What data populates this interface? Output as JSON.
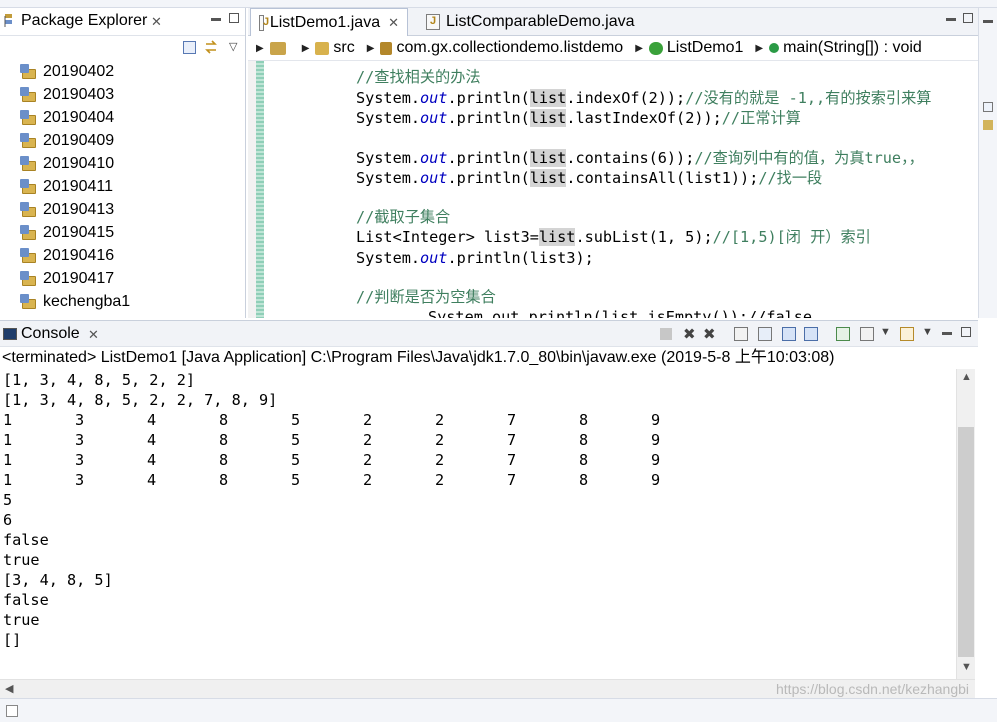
{
  "package_explorer": {
    "title": "Package Explorer",
    "close_glyph": "✕",
    "projects": [
      "20190402",
      "20190403",
      "20190404",
      "20190409",
      "20190410",
      "20190411",
      "20190413",
      "20190415",
      "20190416",
      "20190417",
      "kechengba1"
    ]
  },
  "editor": {
    "tabs": [
      {
        "label": "ListDemo1.java",
        "close_glyph": "✕"
      },
      {
        "label": "ListComparableDemo.java"
      }
    ],
    "breadcrumb": [
      "src",
      "com.gx.collectiondemo.listdemo",
      "ListDemo1",
      "main(String[]) : void"
    ],
    "code": {
      "l1": "//查找相关的办法",
      "l2_a": "System.",
      "l2_b": "out",
      "l2_c": ".println(",
      "l2_d": "list",
      "l2_e": ".indexOf(2));",
      "l2_f": "//没有的就是 -1,,有的按索引来算",
      "l3_a": "System.",
      "l3_b": "out",
      "l3_c": ".println(",
      "l3_d": "list",
      "l3_e": ".lastIndexOf(2));",
      "l3_f": "//正常计算",
      "l4_a": "System.",
      "l4_b": "out",
      "l4_c": ".println(",
      "l4_d": "list",
      "l4_e": ".contains(6));",
      "l4_f": "//查询列中有的值，为真true，，",
      "l5_a": "System.",
      "l5_b": "out",
      "l5_c": ".println(",
      "l5_d": "list",
      "l5_e": ".containsAll(list1));",
      "l5_f": "//找一段",
      "l6": "//截取子集合",
      "l7_a": "List<Integer> list3=",
      "l7_b": "list",
      "l7_c": ".subList(1, 5);",
      "l7_d": "//[1,5)[闭 开）索引",
      "l8_a": "System.",
      "l8_b": "out",
      "l8_c": ".println(list3);",
      "l9": "//判断是否为空集合",
      "l10": "System.out.println(list.isEmpty());//falsе"
    }
  },
  "console": {
    "title": "Console",
    "close_glyph": "✕",
    "header": "<terminated> ListDemo1 [Java Application] C:\\Program Files\\Java\\jdk1.7.0_80\\bin\\javaw.exe (2019-5-8 上午10:03:08)",
    "lines": [
      "[1, 3, 4, 8, 5, 2, 2]",
      "[1, 3, 4, 8, 5, 2, 2, 7, 8, 9]"
    ],
    "grid_rows": [
      [
        "1",
        "3",
        "4",
        "8",
        "5",
        "2",
        "2",
        "7",
        "8",
        "9"
      ],
      [
        "1",
        "3",
        "4",
        "8",
        "5",
        "2",
        "2",
        "7",
        "8",
        "9"
      ],
      [
        "1",
        "3",
        "4",
        "8",
        "5",
        "2",
        "2",
        "7",
        "8",
        "9"
      ],
      [
        "1",
        "3",
        "4",
        "8",
        "5",
        "2",
        "2",
        "7",
        "8",
        "9"
      ]
    ],
    "tail_lines": [
      "5",
      "6",
      "false",
      "true",
      "[3, 4, 8, 5]",
      "false",
      "true",
      "[]"
    ]
  },
  "watermark": "https://blog.csdn.net/kezhangbi",
  "colors": {
    "comment": "#3f7f5f",
    "field": "#0000c0",
    "highlight": "#d4d4d4",
    "change_bar": "#8fcfb8"
  }
}
